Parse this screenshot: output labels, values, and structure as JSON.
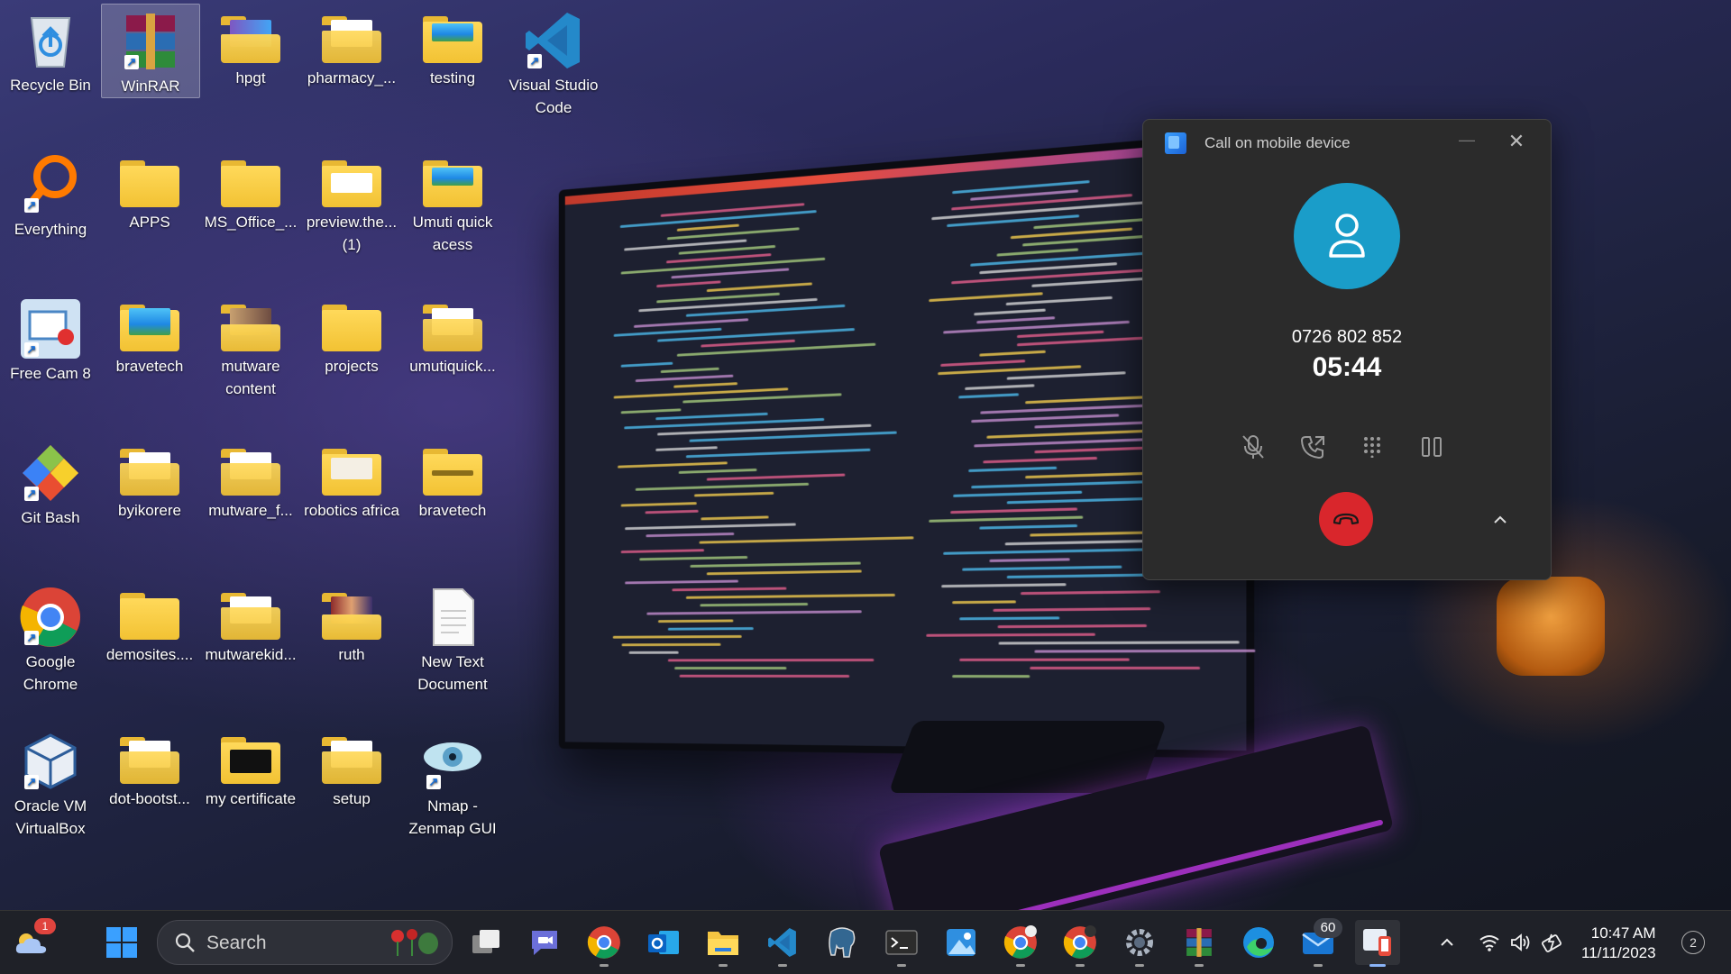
{
  "desktop": {
    "icons": [
      {
        "label": "Recycle Bin"
      },
      {
        "label": "WinRAR"
      },
      {
        "label": "hpgt"
      },
      {
        "label": "pharmacy_..."
      },
      {
        "label": "testing"
      },
      {
        "label": "Visual Studio Code"
      },
      {
        "label": "Everything"
      },
      {
        "label": "APPS"
      },
      {
        "label": "MS_Office_..."
      },
      {
        "label": "preview.the... (1)"
      },
      {
        "label": "Umuti quick acess"
      },
      {
        "label": "Free Cam 8"
      },
      {
        "label": "bravetech"
      },
      {
        "label": "mutware content"
      },
      {
        "label": "projects"
      },
      {
        "label": "umutiquick..."
      },
      {
        "label": "Git Bash"
      },
      {
        "label": "byikorere"
      },
      {
        "label": "mutware_f..."
      },
      {
        "label": "robotics africa"
      },
      {
        "label": "bravetech"
      },
      {
        "label": "Google Chrome"
      },
      {
        "label": "demosites...."
      },
      {
        "label": "mutwarekid..."
      },
      {
        "label": "ruth"
      },
      {
        "label": "New Text Document"
      },
      {
        "label": "Oracle VM VirtualBox"
      },
      {
        "label": "dot-bootst..."
      },
      {
        "label": "my certificate"
      },
      {
        "label": "setup"
      },
      {
        "label": "Nmap - Zenmap GUI"
      }
    ]
  },
  "call_window": {
    "title": "Call on mobile device",
    "phone_number": "0726 802 852",
    "duration": "05:44",
    "avatar_color": "#1a9dc9",
    "hangup_color": "#d9262c"
  },
  "taskbar": {
    "search_label": "Search",
    "weather_badge": "1",
    "mail_badge": "60",
    "clock_time": "10:47 AM",
    "clock_date": "11/11/2023",
    "notification_count": "2"
  }
}
